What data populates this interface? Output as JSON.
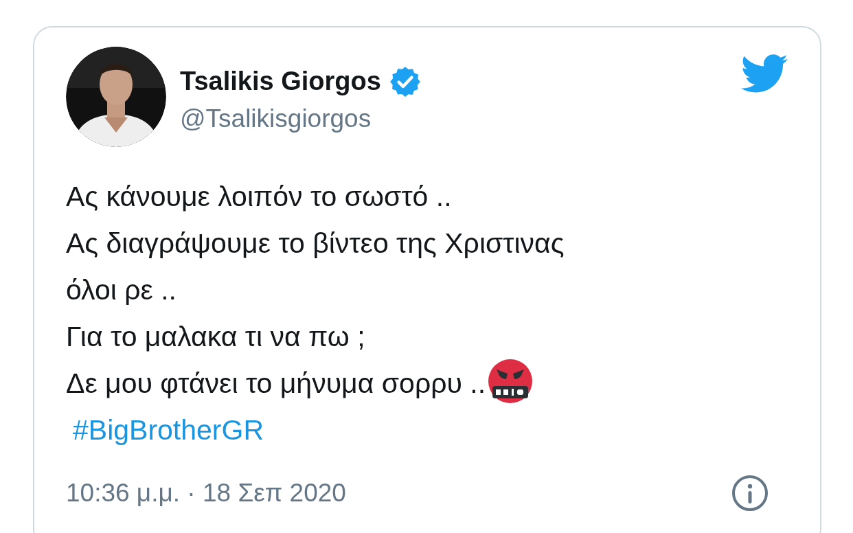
{
  "tweet": {
    "author": {
      "name": "Tsalikis Giorgos",
      "verified": true,
      "handle": "@Tsalikisgiorgos"
    },
    "lines": [
      {
        "kind": "text",
        "text": "Ας κάνουμε λοιπόν το σωστό .."
      },
      {
        "kind": "text",
        "text": "Ας διαγράψουμε το βίντεο της Χριστινας"
      },
      {
        "kind": "text",
        "text": "όλοι ρε .."
      },
      {
        "kind": "text",
        "text": "Για το μαλακα τι να πω ;"
      },
      {
        "kind": "emoji",
        "text": "Δε μου φτάνει το μήνυμα σορρυ .."
      },
      {
        "kind": "hashtag",
        "text": "#BigBrotherGR"
      }
    ],
    "timestamp": "10:36 μ.μ. · 18 Σεπ 2020"
  }
}
